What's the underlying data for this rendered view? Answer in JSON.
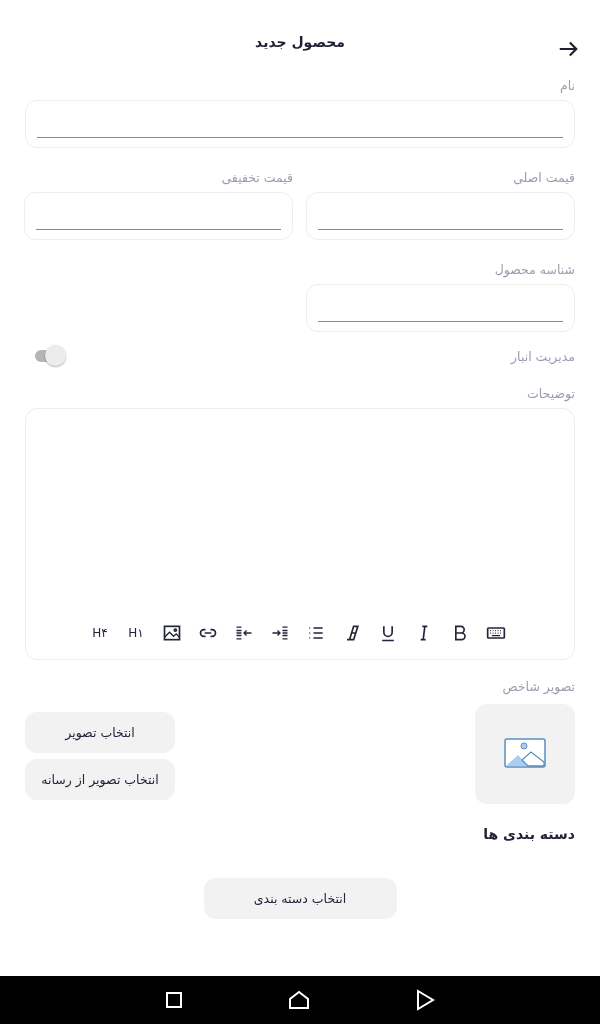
{
  "header": {
    "title": "محصول جدید"
  },
  "field_rows": [
    [
      {
        "label": "نام"
      }
    ],
    [
      {
        "label": "قیمت اصلی"
      },
      {
        "label": "قیمت تخفیفی"
      }
    ],
    [
      {
        "label": "شناسه محصول"
      }
    ]
  ],
  "inventory_toggle": {
    "label": "مدیریت انبار",
    "on": false
  },
  "description": {
    "label": "توضیحات",
    "heading_buttons": [
      "H۱",
      "H۴"
    ]
  },
  "cover_image": {
    "label": "تصویر شاخص",
    "buttons": [
      "انتخاب تصویر",
      "انتخاب تصویر از رسانه"
    ]
  },
  "categories": {
    "title": "دسته بندی ها",
    "button": "انتخاب دسته بندی"
  }
}
